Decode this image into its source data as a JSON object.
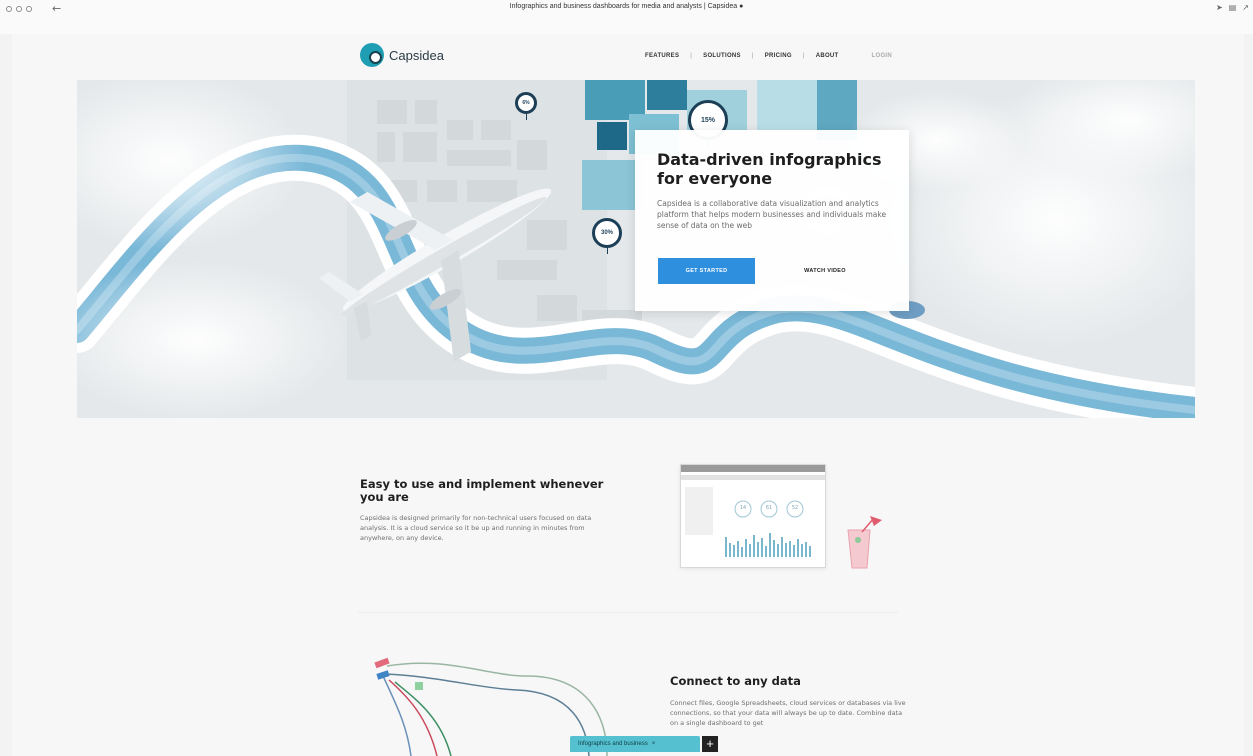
{
  "browser": {
    "window_title": "Infographics and business dashboards for media and analysts | Capsidea",
    "back_icon": "arrow-left-icon",
    "lock_icon": "lock-icon",
    "right_icons": [
      "share-icon",
      "sidebar-icon",
      "expand-icon"
    ]
  },
  "nav": {
    "logo_text": "Capsidea",
    "items": [
      "FEATURES",
      "SOLUTIONS",
      "PRICING",
      "ABOUT"
    ],
    "separator": "|",
    "login": "LOGIN"
  },
  "hero": {
    "title": "Data-driven infographics for everyone",
    "description": "Capsidea is a collaborative data visualization and analytics platform that helps modern businesses and individuals make sense of data on the web",
    "cta_label": "GET STARTED",
    "video_label": "WATCH VIDEO",
    "pins": [
      "15%",
      "30%",
      "6%"
    ]
  },
  "feature_easy": {
    "title": "Easy to use and implement whenever you are",
    "description": "Capsidea is designed primarily for non-technical users focused on data analysis. It is a cloud service so it be up and running in minutes from anywhere, on any device.",
    "gauges": [
      "14",
      "61",
      "52"
    ]
  },
  "feature_connect": {
    "title": "Connect to any data",
    "description": "Connect files, Google Spreadsheets, cloud services or databases via live connections, so that your data will always be up to date. Combine data on a single dashboard to get"
  },
  "bottom_tab": {
    "label": "Infographics and business",
    "close": "×",
    "plus": "+"
  },
  "colors": {
    "accent": "#2f8fdf",
    "brand": "#1f9db3",
    "river": "#6fb3d6",
    "pin": "#1d3e57"
  }
}
